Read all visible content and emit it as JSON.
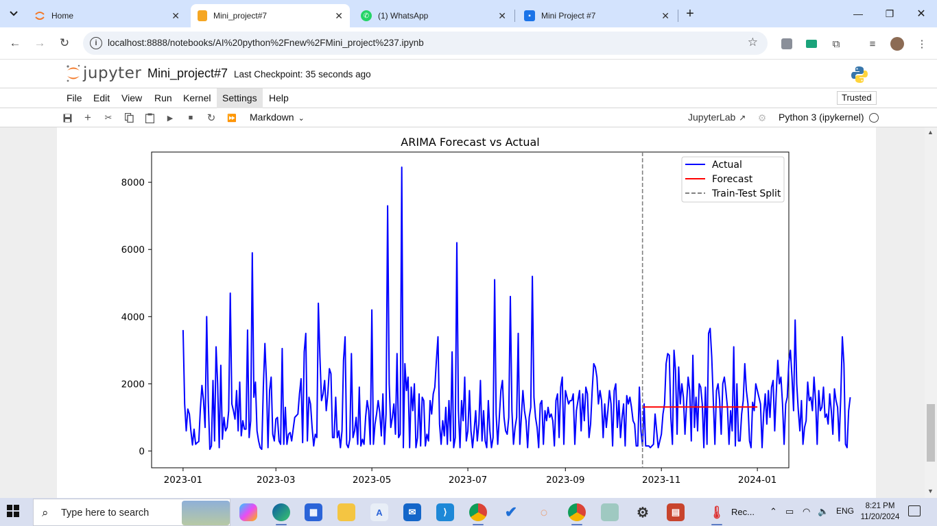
{
  "browser": {
    "tabs": [
      {
        "label": "Home",
        "icon": "jupyter-icon",
        "active": false
      },
      {
        "label": "Mini_project#7",
        "icon": "notebook-icon",
        "active": true
      },
      {
        "label": "(1) WhatsApp",
        "icon": "whatsapp-icon",
        "active": false
      },
      {
        "label": "Mini Project #7",
        "icon": "classroom-icon",
        "active": false
      }
    ],
    "url": "localhost:8888/notebooks/AI%20python%2Fnew%2FMini_project%237.ipynb"
  },
  "jupyter": {
    "logo_text": "jupyter",
    "notebook_title": "Mini_project#7",
    "checkpoint": "Last Checkpoint: 35 seconds ago",
    "menu": [
      "File",
      "Edit",
      "View",
      "Run",
      "Kernel",
      "Settings",
      "Help"
    ],
    "active_menu": "Settings",
    "trusted": "Trusted",
    "cell_type": "Markdown",
    "jupyterlab_link": "JupyterLab",
    "kernel_name": "Python 3 (ipykernel)"
  },
  "chart_data": {
    "type": "line",
    "title": "ARIMA Forecast vs Actual",
    "xlabel": "",
    "ylabel": "",
    "x_ticks": [
      "2023-01",
      "2023-03",
      "2023-05",
      "2023-07",
      "2023-09",
      "2023-11",
      "2024-01"
    ],
    "y_ticks": [
      "0",
      "2000",
      "4000",
      "6000",
      "8000"
    ],
    "ylim": [
      -500,
      8900
    ],
    "xlim": [
      "2022-12-12",
      "2024-01-21"
    ],
    "grid": false,
    "legend_position": "top-right",
    "split_date": "2023-10-20",
    "series": [
      {
        "name": "Actual",
        "color": "#0000ff",
        "start": "2023-01-01",
        "step_days": 1,
        "values": [
          3600,
          1400,
          600,
          1250,
          1100,
          600,
          180,
          650,
          200,
          250,
          280,
          1250,
          1950,
          1500,
          700,
          4000,
          1500,
          50,
          150,
          2100,
          300,
          3100,
          2000,
          100,
          2550,
          350,
          1000,
          600,
          700,
          1200,
          4700,
          1400,
          1200,
          950,
          1800,
          600,
          2050,
          450,
          900,
          650,
          650,
          3600,
          400,
          900,
          5900,
          1600,
          2050,
          600,
          300,
          100,
          50,
          1900,
          3200,
          2100,
          100,
          1800,
          2200,
          500,
          300,
          950,
          1000,
          300,
          200,
          3050,
          200,
          1300,
          200,
          500,
          550,
          300,
          650,
          1000,
          1050,
          1100,
          1700,
          2150,
          250,
          2950,
          3500,
          300,
          1600,
          1400,
          700,
          150,
          500,
          400,
          4400,
          2800,
          1500,
          1700,
          2100,
          1200,
          1700,
          2450,
          2300,
          400,
          400,
          1600,
          400,
          600,
          100,
          600,
          2700,
          3400,
          200,
          100,
          350,
          2900,
          400,
          600,
          1000,
          200,
          1900,
          150,
          350,
          200,
          1000,
          1500,
          1200,
          200,
          4200,
          200,
          800,
          1100,
          1500,
          1150,
          450,
          1700,
          200,
          1100,
          7300,
          2000,
          700,
          1000,
          1400,
          500,
          2900,
          400,
          500,
          8450,
          100,
          2600,
          1800,
          2200,
          100,
          1900,
          1200,
          2000,
          100,
          400,
          1700,
          150,
          1600,
          1500,
          150,
          500,
          300,
          1500,
          1100,
          1700,
          1900,
          2700,
          3400,
          800,
          200,
          900,
          450,
          1300,
          200,
          1500,
          300,
          2950,
          100,
          400,
          6200,
          1200,
          100,
          1500,
          900,
          2200,
          300,
          600,
          1800,
          600,
          100,
          600,
          1200,
          300,
          800,
          2100,
          300,
          1200,
          300,
          100,
          1500,
          600,
          100,
          400,
          5100,
          1100,
          200,
          1000,
          1800,
          2100,
          1000,
          600,
          500,
          1000,
          4600,
          1200,
          200,
          700,
          1000,
          3500,
          200,
          1000,
          1800,
          1200,
          900,
          100,
          1000,
          1300,
          5200,
          1600,
          1000,
          700,
          100,
          1400,
          1500,
          200,
          1200,
          900,
          1300,
          1000,
          1100,
          900,
          150,
          1500,
          1700,
          400,
          1900,
          2200,
          200,
          1800,
          1600,
          1400,
          1500,
          1500,
          1700,
          200,
          1200,
          1500,
          1800,
          600,
          1700,
          900,
          1900,
          1700,
          400,
          800,
          1800,
          2600,
          2500,
          2200,
          1400,
          1800,
          1500,
          400,
          1400,
          700,
          1200,
          1800,
          1400,
          150,
          1800,
          2000,
          700,
          1500,
          400,
          1000,
          1400,
          150,
          1650,
          1400,
          1600,
          1300,
          900,
          800,
          150,
          150,
          1900,
          600,
          150,
          1400,
          150,
          150,
          150,
          100,
          150,
          200,
          1100,
          600,
          100,
          300,
          500,
          1100,
          1400,
          2600,
          2900,
          2850,
          1000,
          200,
          3000,
          2400,
          500,
          2500,
          1400,
          2000,
          1600,
          500,
          1400,
          2200,
          1800,
          300,
          2850,
          700,
          1600,
          600,
          2000,
          1900,
          1400
        ],
        "values_test": [
          100,
          1900,
          200,
          3500,
          3650,
          2800,
          1500,
          200,
          1800,
          2000,
          1500,
          500,
          2000,
          2200,
          1800,
          1300,
          200,
          1200,
          600,
          3100,
          150,
          2000,
          300,
          300,
          1100,
          1500,
          2600,
          1800,
          1400,
          300,
          100,
          1450,
          1200,
          2000,
          1800,
          1600,
          1400,
          100,
          1100,
          1700,
          800,
          1800,
          1000,
          1900,
          2100,
          600,
          1700,
          2700,
          2000,
          2200,
          1400,
          200,
          1400,
          1600,
          2650,
          3000,
          2200,
          1200,
          3900,
          2000,
          1200,
          600,
          1500,
          200,
          700,
          900,
          2050,
          1500,
          1600,
          1200,
          2200,
          1500,
          200,
          1800,
          1200,
          1300,
          1900,
          1000,
          1100,
          800,
          1700,
          1200,
          500,
          1850,
          1500,
          1300,
          300,
          1600,
          3400,
          2600,
          200,
          100,
          1200,
          1600
        ]
      },
      {
        "name": "Forecast",
        "color": "#ff0000",
        "start": "2023-10-20",
        "end": "2024-01-01",
        "value": 1310
      },
      {
        "name": "Train-Test Split",
        "color": "#808080",
        "style": "dashed"
      }
    ]
  },
  "taskbar": {
    "search_placeholder": "Type here to search",
    "rec_label": "Rec...",
    "language": "ENG",
    "time": "8:21 PM",
    "date": "11/20/2024"
  }
}
